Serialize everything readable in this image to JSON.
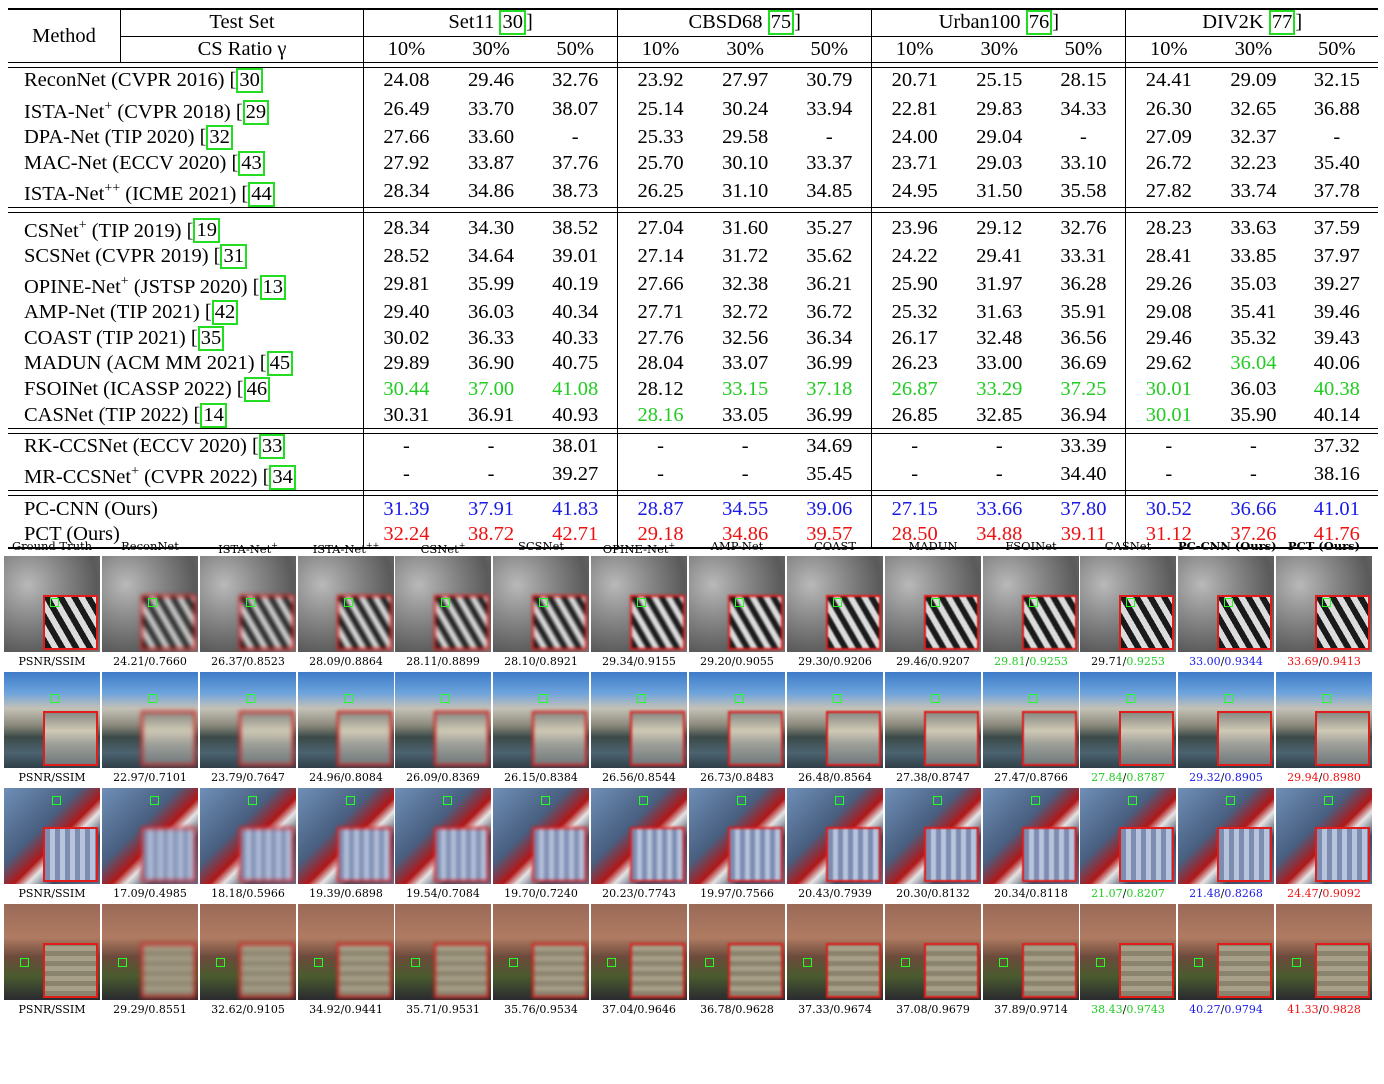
{
  "table": {
    "header": {
      "method": "Method",
      "test_set": "Test Set",
      "cs_ratio": "CS Ratio γ",
      "datasets": [
        {
          "name": "Set11 ",
          "ref": "30"
        },
        {
          "name": "CBSD68 ",
          "ref": "75"
        },
        {
          "name": "Urban100 ",
          "ref": "76"
        },
        {
          "name": "DIV2K ",
          "ref": "77"
        }
      ],
      "ratios": [
        "10%",
        "30%",
        "50%"
      ]
    },
    "groups": [
      [
        {
          "name": "ReconNet (CVPR 2016) [",
          "ref": "30",
          "values": [
            "24.08",
            "29.46",
            "32.76",
            "23.92",
            "27.97",
            "30.79",
            "20.71",
            "25.15",
            "28.15",
            "24.41",
            "29.09",
            "32.15"
          ]
        },
        {
          "name": "ISTA-Net",
          "sup": "+",
          "rest": " (CVPR 2018) [",
          "ref": "29",
          "values": [
            "26.49",
            "33.70",
            "38.07",
            "25.14",
            "30.24",
            "33.94",
            "22.81",
            "29.83",
            "34.33",
            "26.30",
            "32.65",
            "36.88"
          ]
        },
        {
          "name": "DPA-Net (TIP 2020) [",
          "ref": "32",
          "values": [
            "27.66",
            "33.60",
            "-",
            "25.33",
            "29.58",
            "-",
            "24.00",
            "29.04",
            "-",
            "27.09",
            "32.37",
            "-"
          ]
        },
        {
          "name": "MAC-Net (ECCV 2020) [",
          "ref": "43",
          "values": [
            "27.92",
            "33.87",
            "37.76",
            "25.70",
            "30.10",
            "33.37",
            "23.71",
            "29.03",
            "33.10",
            "26.72",
            "32.23",
            "35.40"
          ]
        },
        {
          "name": "ISTA-Net",
          "sup": "++",
          "rest": " (ICME 2021) [",
          "ref": "44",
          "values": [
            "28.34",
            "34.86",
            "38.73",
            "26.25",
            "31.10",
            "34.85",
            "24.95",
            "31.50",
            "35.58",
            "27.82",
            "33.74",
            "37.78"
          ]
        }
      ],
      [
        {
          "name": "CSNet",
          "sup": "+",
          "rest": " (TIP 2019) [",
          "ref": "19",
          "values": [
            "28.34",
            "34.30",
            "38.52",
            "27.04",
            "31.60",
            "35.27",
            "23.96",
            "29.12",
            "32.76",
            "28.23",
            "33.63",
            "37.59"
          ]
        },
        {
          "name": "SCSNet (CVPR 2019) [",
          "ref": "31",
          "values": [
            "28.52",
            "34.64",
            "39.01",
            "27.14",
            "31.72",
            "35.62",
            "24.22",
            "29.41",
            "33.31",
            "28.41",
            "33.85",
            "37.97"
          ]
        },
        {
          "name": "OPINE-Net",
          "sup": "+",
          "rest": " (JSTSP 2020) [",
          "ref": "13",
          "values": [
            "29.81",
            "35.99",
            "40.19",
            "27.66",
            "32.38",
            "36.21",
            "25.90",
            "31.97",
            "36.28",
            "29.26",
            "35.03",
            "39.27"
          ]
        },
        {
          "name": "AMP-Net (TIP 2021) [",
          "ref": "42",
          "values": [
            "29.40",
            "36.03",
            "40.34",
            "27.71",
            "32.72",
            "36.72",
            "25.32",
            "31.63",
            "35.91",
            "29.08",
            "35.41",
            "39.46"
          ]
        },
        {
          "name": "COAST (TIP 2021) [",
          "ref": "35",
          "values": [
            "30.02",
            "36.33",
            "40.33",
            "27.76",
            "32.56",
            "36.34",
            "26.17",
            "32.48",
            "36.56",
            "29.46",
            "35.32",
            "39.43"
          ]
        },
        {
          "name": "MADUN (ACM MM 2021) [",
          "ref": "45",
          "values": [
            "29.89",
            "36.90",
            "40.75",
            "28.04",
            "33.07",
            "36.99",
            "26.23",
            "33.00",
            "36.69",
            "29.62",
            "36.04",
            "40.06"
          ],
          "green": [
            10
          ]
        },
        {
          "name": "FSOINet (ICASSP 2022) [",
          "ref": "46",
          "values": [
            "30.44",
            "37.00",
            "41.08",
            "28.12",
            "33.15",
            "37.18",
            "26.87",
            "33.29",
            "37.25",
            "30.01",
            "36.03",
            "40.38"
          ],
          "green": [
            0,
            1,
            2,
            4,
            5,
            6,
            7,
            8,
            9,
            11
          ]
        },
        {
          "name": "CASNet (TIP 2022) [",
          "ref": "14",
          "values": [
            "30.31",
            "36.91",
            "40.93",
            "28.16",
            "33.05",
            "36.99",
            "26.85",
            "32.85",
            "36.94",
            "30.01",
            "35.90",
            "40.14"
          ],
          "green": [
            3,
            9
          ]
        }
      ],
      [
        {
          "name": "RK-CCSNet (ECCV 2020) [",
          "ref": "33",
          "values": [
            "-",
            "-",
            "38.01",
            "-",
            "-",
            "34.69",
            "-",
            "-",
            "33.39",
            "-",
            "-",
            "37.32"
          ]
        },
        {
          "name": "MR-CCSNet",
          "sup": "+",
          "rest": " (CVPR 2022) [",
          "ref": "34",
          "values": [
            "-",
            "-",
            "39.27",
            "-",
            "-",
            "35.45",
            "-",
            "-",
            "34.40",
            "-",
            "-",
            "38.16"
          ]
        }
      ],
      [
        {
          "name": "PC-CNN (Ours)",
          "bold": true,
          "color": "blue",
          "values": [
            "31.39",
            "37.91",
            "41.83",
            "28.87",
            "34.55",
            "39.06",
            "27.15",
            "33.66",
            "37.80",
            "30.52",
            "36.66",
            "41.01"
          ]
        },
        {
          "name": "PCT (Ours)",
          "bold": true,
          "color": "red",
          "values": [
            "32.24",
            "38.72",
            "42.71",
            "29.18",
            "34.86",
            "39.57",
            "28.50",
            "34.88",
            "39.11",
            "31.12",
            "37.26",
            "41.76"
          ]
        }
      ]
    ]
  },
  "visual": {
    "captions": [
      {
        "t": "Ground Truth"
      },
      {
        "t": "ReconNet"
      },
      {
        "t": "ISTA-Net",
        "s": "+"
      },
      {
        "t": "ISTA-Net",
        "s": "++"
      },
      {
        "t": "CSNet",
        "s": "+"
      },
      {
        "t": "SCSNet"
      },
      {
        "t": "OPINE-Net",
        "s": "+"
      },
      {
        "t": "AMP-Net"
      },
      {
        "t": "COAST"
      },
      {
        "t": "MADUN"
      },
      {
        "t": "FSOINet"
      },
      {
        "t": "CASNet"
      },
      {
        "t": "PC-CNN (Ours)",
        "b": true
      },
      {
        "t": "PCT (Ours)",
        "b": true
      }
    ],
    "metric_label": "PSNR/SSIM",
    "rows": [
      {
        "scene": "parrot",
        "m": [
          [
            "24.21",
            "0.7660"
          ],
          [
            "26.37",
            "0.8523"
          ],
          [
            "28.09",
            "0.8864"
          ],
          [
            "28.11",
            "0.8899"
          ],
          [
            "28.10",
            "0.8921"
          ],
          [
            "29.34",
            "0.9155"
          ],
          [
            "29.20",
            "0.9055"
          ],
          [
            "29.30",
            "0.9206"
          ],
          [
            "29.46",
            "0.9207"
          ],
          [
            "29.81",
            "0.9253"
          ],
          [
            "29.71",
            "0.9253"
          ],
          [
            "33.00",
            "0.9344"
          ],
          [
            "33.69",
            "0.9413"
          ]
        ],
        "hl": {
          "9": [
            "g",
            "g"
          ],
          "10": [
            "",
            "g"
          ],
          "11": [
            "bl",
            "bl"
          ],
          "12": [
            "r",
            "r"
          ]
        }
      },
      {
        "scene": "castle",
        "m": [
          [
            "22.97",
            "0.7101"
          ],
          [
            "23.79",
            "0.7647"
          ],
          [
            "24.96",
            "0.8084"
          ],
          [
            "26.09",
            "0.8369"
          ],
          [
            "26.15",
            "0.8384"
          ],
          [
            "26.56",
            "0.8544"
          ],
          [
            "26.73",
            "0.8483"
          ],
          [
            "26.48",
            "0.8564"
          ],
          [
            "27.38",
            "0.8747"
          ],
          [
            "27.47",
            "0.8766"
          ],
          [
            "27.84",
            "0.8787"
          ],
          [
            "29.32",
            "0.8905"
          ],
          [
            "29.94",
            "0.8980"
          ]
        ],
        "hl": {
          "10": [
            "g",
            "g"
          ],
          "11": [
            "bl",
            "bl"
          ],
          "12": [
            "r",
            "r"
          ]
        }
      },
      {
        "scene": "roof",
        "m": [
          [
            "17.09",
            "0.4985"
          ],
          [
            "18.18",
            "0.5966"
          ],
          [
            "19.39",
            "0.6898"
          ],
          [
            "19.54",
            "0.7084"
          ],
          [
            "19.70",
            "0.7240"
          ],
          [
            "20.23",
            "0.7743"
          ],
          [
            "19.97",
            "0.7566"
          ],
          [
            "20.43",
            "0.7939"
          ],
          [
            "20.30",
            "0.8132"
          ],
          [
            "20.34",
            "0.8118"
          ],
          [
            "21.07",
            "0.8207"
          ],
          [
            "21.48",
            "0.8268"
          ],
          [
            "24.47",
            "0.9092"
          ]
        ],
        "hl": {
          "10": [
            "g",
            "g"
          ],
          "11": [
            "bl",
            "bl"
          ],
          "12": [
            "r",
            "r"
          ]
        }
      },
      {
        "scene": "skin",
        "m": [
          [
            "29.29",
            "0.8551"
          ],
          [
            "32.62",
            "0.9105"
          ],
          [
            "34.92",
            "0.9441"
          ],
          [
            "35.71",
            "0.9531"
          ],
          [
            "35.76",
            "0.9534"
          ],
          [
            "37.04",
            "0.9646"
          ],
          [
            "36.78",
            "0.9628"
          ],
          [
            "37.33",
            "0.9674"
          ],
          [
            "37.08",
            "0.9679"
          ],
          [
            "37.89",
            "0.9714"
          ],
          [
            "38.43",
            "0.9743"
          ],
          [
            "40.27",
            "0.9794"
          ],
          [
            "41.33",
            "0.9828"
          ]
        ],
        "hl": {
          "10": [
            "g",
            "g"
          ],
          "11": [
            "bl",
            "bl"
          ],
          "12": [
            "r",
            "r"
          ]
        }
      }
    ]
  },
  "colors": {
    "best": "#ee1111",
    "second": "#1a1ae6",
    "third": "#22cc22",
    "ref_box": "#22dd22",
    "zoom_box": "#e21b1b"
  }
}
